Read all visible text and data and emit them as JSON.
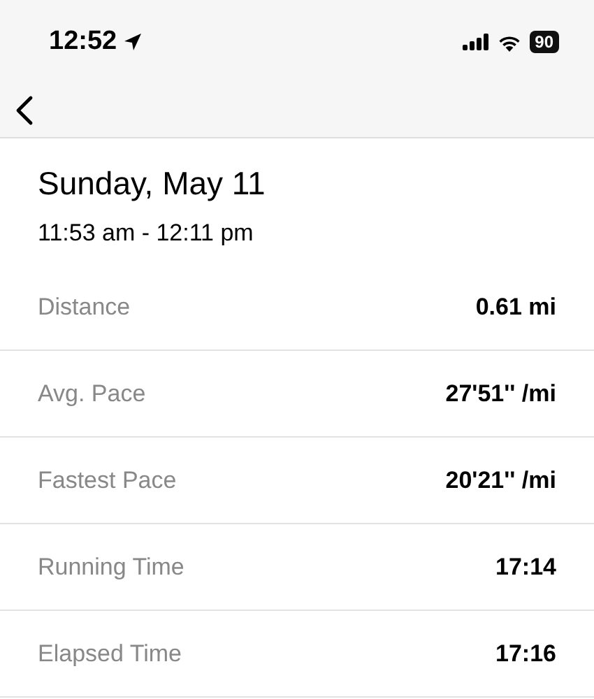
{
  "status_bar": {
    "time": "12:52",
    "battery": "90"
  },
  "header": {
    "title": "Sunday, May 11",
    "time_range": "11:53 am - 12:11 pm"
  },
  "stats": [
    {
      "label": "Distance",
      "value": "0.61 mi"
    },
    {
      "label": "Avg. Pace",
      "value": "27'51'' /mi"
    },
    {
      "label": "Fastest Pace",
      "value": "20'21'' /mi"
    },
    {
      "label": "Running Time",
      "value": "17:14"
    },
    {
      "label": "Elapsed Time",
      "value": "17:16"
    }
  ]
}
